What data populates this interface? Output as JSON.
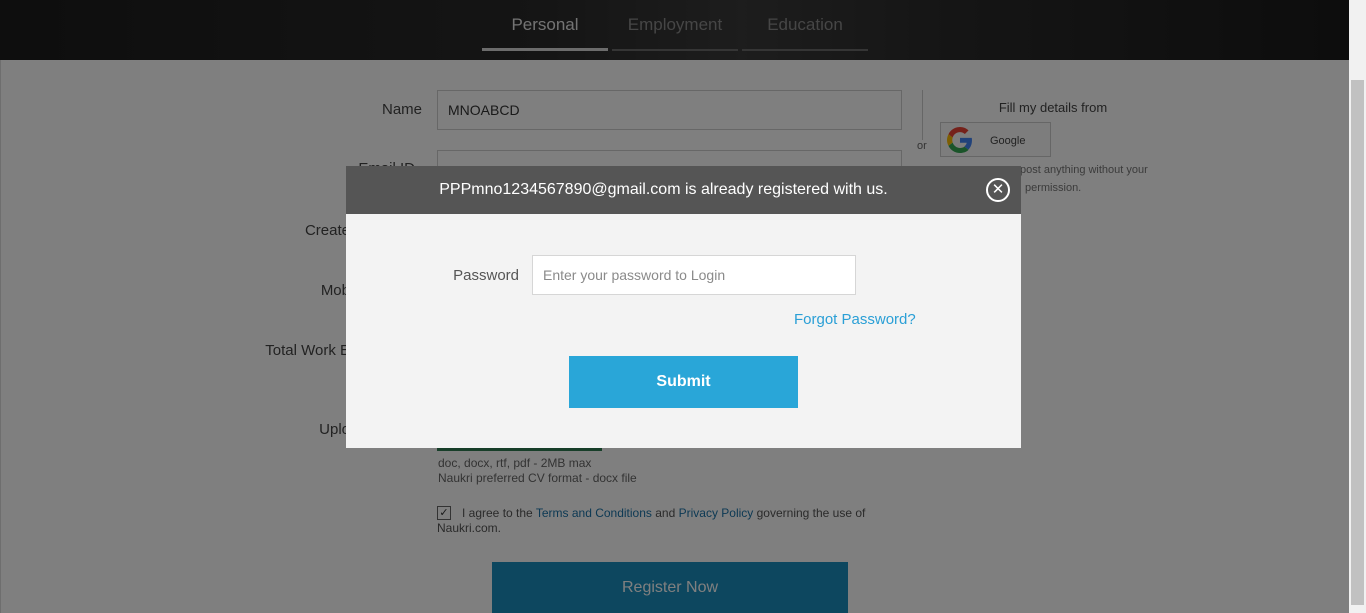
{
  "tabs": [
    {
      "label": "Personal",
      "active": true
    },
    {
      "label": "Employment",
      "active": false
    },
    {
      "label": "Education",
      "active": false
    }
  ],
  "form": {
    "name_label": "Name",
    "name_value": "MNOABCD",
    "email_label": "Email ID",
    "email_required": "*",
    "create_label": "Create",
    "mobile_label": "Mob",
    "work_exp_label": "Total Work E",
    "upload_label": "Uplo",
    "file_types": "doc, docx, rtf, pdf - 2MB max",
    "preferred_format": "Naukri preferred CV format - docx file",
    "agree_prefix": "I agree to the ",
    "terms_link": "Terms and Conditions",
    "agree_mid": " and ",
    "privacy_link": "Privacy Policy",
    "agree_suffix": " governing the use of Naukri.com.",
    "register_button": "Register Now"
  },
  "social": {
    "or_text": "or",
    "fill_title": "Fill my details from",
    "google_label": "Google",
    "note_line1": "post anything without your",
    "note_line2": "permission."
  },
  "modal": {
    "title": "PPPmno1234567890@gmail.com is already registered with us.",
    "close_icon": "close-circle-icon",
    "password_label": "Password",
    "password_placeholder": "Enter your password to Login",
    "forgot_link": "Forgot Password?",
    "submit_button": "Submit"
  },
  "colors": {
    "modal_header": "#555555",
    "submit": "#29a6d8",
    "link": "#2a9fd6",
    "register": "#1a8fbf"
  }
}
